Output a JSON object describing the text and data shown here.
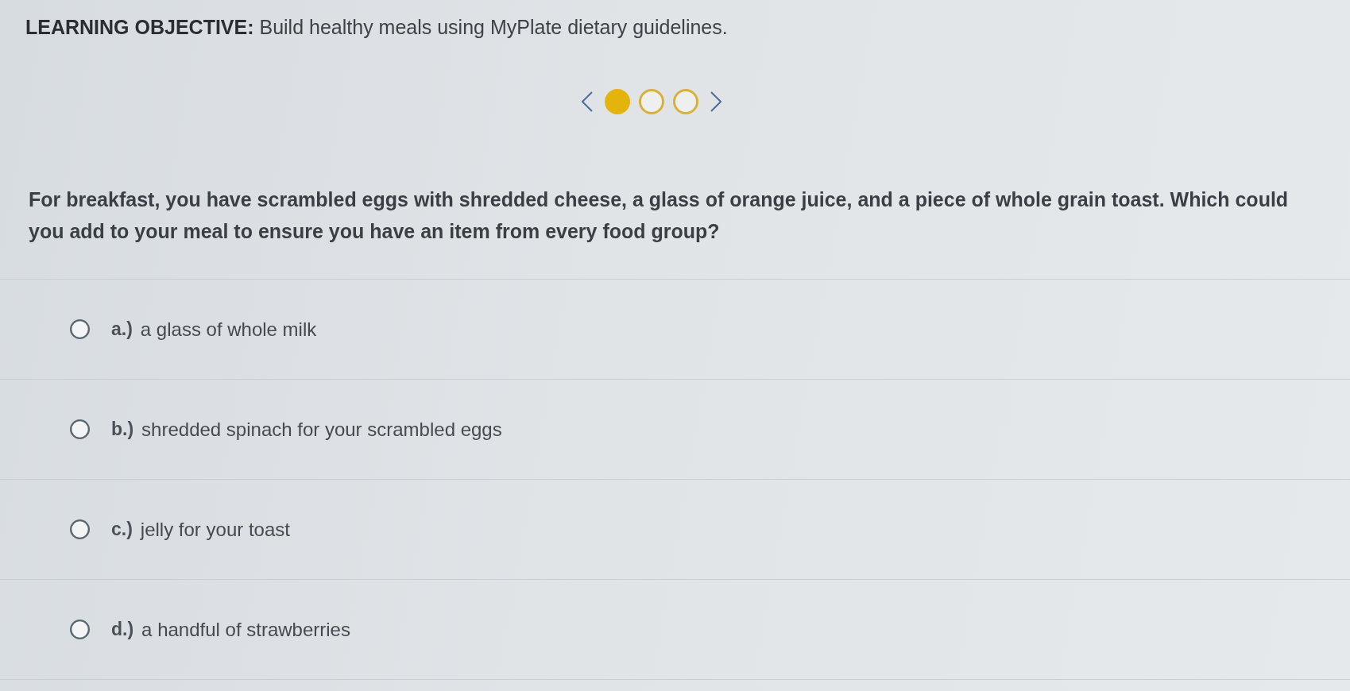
{
  "objective": "**LEARNING OBJECTIVE:** Build healthy meals using MyPlate dietary guidelines.",
  "pager": {
    "pages": [
      {
        "selected": true
      },
      {
        "selected": false
      },
      {
        "selected": false
      }
    ]
  },
  "question": "For breakfast, you have scrambled eggs with shredded cheese, a glass of orange juice, and a piece of whole grain toast. Which could you add to your meal to ensure you have an item from every food group?",
  "options": [
    {
      "letter": "a.)",
      "text": "a glass of whole milk",
      "selected": false
    },
    {
      "letter": "b.)",
      "text": "shredded spinach for your scrambled eggs",
      "selected": false
    },
    {
      "letter": "c.)",
      "text": "jelly for your toast",
      "selected": false
    },
    {
      "letter": "d.)",
      "text": "a handful of strawberries",
      "selected": false
    }
  ]
}
